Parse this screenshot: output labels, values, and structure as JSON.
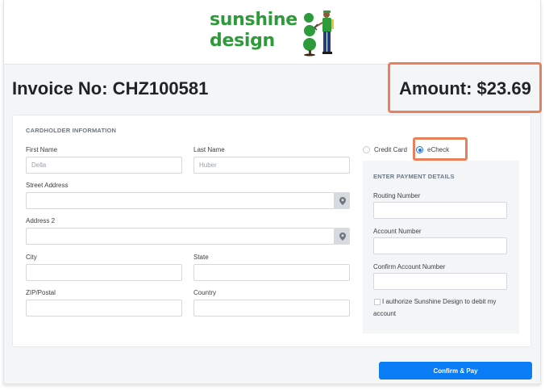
{
  "brand": {
    "line1": "sunshine",
    "line2": "design",
    "color": "#2e9b3a"
  },
  "invoice": {
    "title": "Invoice No: CHZ100581",
    "amount": "Amount: $23.69"
  },
  "cardholder": {
    "section_title": "CARDHOLDER INFORMATION",
    "first_name_label": "First Name",
    "first_name_placeholder": "Della",
    "last_name_label": "Last Name",
    "last_name_placeholder": "Huber",
    "street_label": "Street Address",
    "address2_label": "Address 2",
    "city_label": "City",
    "state_label": "State",
    "zip_label": "ZIP/Postal",
    "country_label": "Country"
  },
  "payment": {
    "credit_card_label": "Credit Card",
    "echeck_label": "eCheck",
    "selected": "eCheck",
    "section_title": "ENTER PAYMENT DETAILS",
    "routing_label": "Routing Number",
    "account_label": "Account Number",
    "confirm_account_label": "Confirm Account Number",
    "authorize_text": "I authorize Sunshine Design to debit my account",
    "confirm_button": "Confirm & Pay"
  },
  "colors": {
    "accent": "#0a7cf5",
    "highlight": "#e8805c",
    "location_button": "#d7dbe0"
  },
  "icons": [
    "location-pin-icon",
    "logo-gardener-illustration"
  ]
}
